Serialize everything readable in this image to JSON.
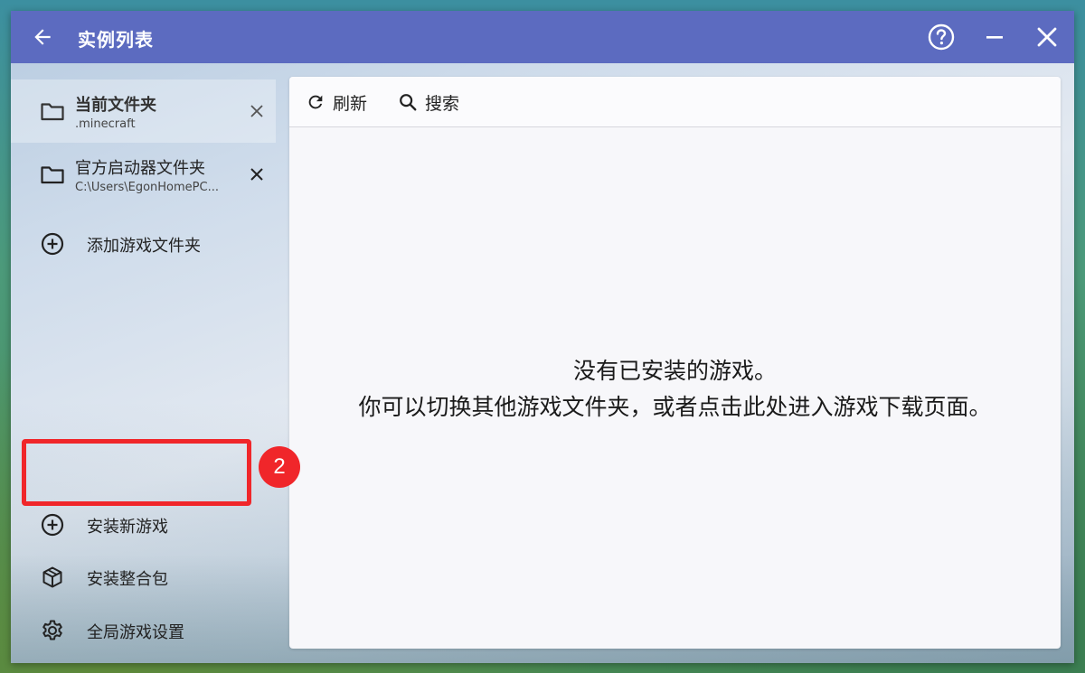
{
  "window": {
    "title": "实例列表",
    "accent_color": "#5c6bc0",
    "icons": {
      "back": "arrow-left-icon",
      "help": "help-circle-icon",
      "minimize": "minimize-icon",
      "close": "close-icon"
    }
  },
  "sidebar": {
    "folders": [
      {
        "name": "当前文件夹",
        "path": ".minecraft",
        "selected": true,
        "icon": "folder-icon"
      },
      {
        "name": "官方启动器文件夹",
        "path": "C:\\Users\\EgonHomePC...",
        "selected": false,
        "icon": "folder-icon"
      }
    ],
    "add_folder": {
      "label": "添加游戏文件夹",
      "icon": "plus-circle-icon"
    },
    "actions": [
      {
        "label": "安装新游戏",
        "icon": "plus-circle-icon",
        "highlighted": true
      },
      {
        "label": "安装整合包",
        "icon": "package-icon"
      },
      {
        "label": "全局游戏设置",
        "icon": "gear-icon"
      }
    ]
  },
  "annotation": {
    "step_number": "2",
    "color": "#f0262a"
  },
  "toolbar": {
    "refresh_label": "刷新",
    "search_label": "搜索"
  },
  "main": {
    "empty_line1": "没有已安装的游戏。",
    "empty_line2": "你可以切换其他游戏文件夹，或者点击此处进入游戏下载页面。"
  }
}
